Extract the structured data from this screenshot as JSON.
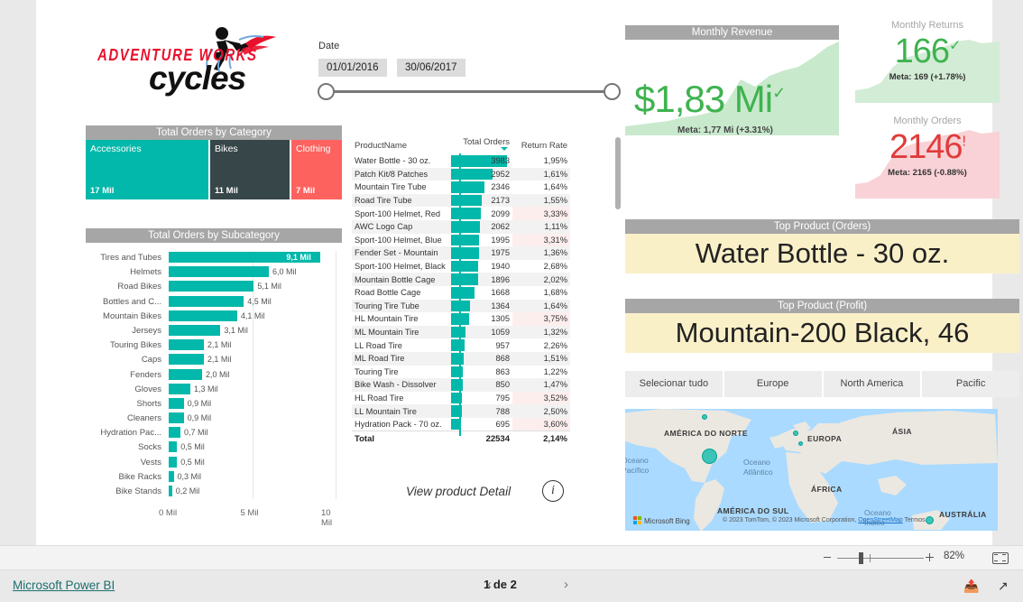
{
  "brand": {
    "top_text": "ADVENTURE WORKS",
    "bottom_text": "cycles",
    "logo_icon": "cyclist-logo-icon"
  },
  "slicer": {
    "label": "Date",
    "start": "01/01/2016",
    "end": "30/06/2017"
  },
  "treemap": {
    "title": "Total Orders by Category",
    "cells": [
      {
        "name": "Accessories",
        "value": "17 Mil",
        "color": "#01b8aa",
        "weight": 17
      },
      {
        "name": "Bikes",
        "value": "11 Mil",
        "color": "#374649",
        "weight": 11
      },
      {
        "name": "Clothing",
        "value": "7 Mil",
        "color": "#fd625e",
        "weight": 7
      }
    ]
  },
  "chart_data": {
    "type": "bar",
    "title": "Total Orders by Subcategory",
    "xlabel": "",
    "ylabel": "",
    "orientation": "horizontal",
    "xlim": [
      0,
      10
    ],
    "xticks": [
      "0 Mil",
      "5 Mil",
      "10 Mil"
    ],
    "bar_color": "#01b8aa",
    "categories": [
      "Tires and Tubes",
      "Helmets",
      "Road Bikes",
      "Bottles and C...",
      "Mountain Bikes",
      "Jerseys",
      "Touring Bikes",
      "Caps",
      "Fenders",
      "Gloves",
      "Shorts",
      "Cleaners",
      "Hydration Pac...",
      "Socks",
      "Vests",
      "Bike Racks",
      "Bike Stands"
    ],
    "values": [
      9.1,
      6.0,
      5.1,
      4.5,
      4.1,
      3.1,
      2.1,
      2.1,
      2.0,
      1.3,
      0.9,
      0.9,
      0.7,
      0.5,
      0.5,
      0.3,
      0.2
    ],
    "labels": [
      "9,1 Mil",
      "6,0 Mil",
      "5,1 Mil",
      "4,5 Mil",
      "4,1 Mil",
      "3,1 Mil",
      "2,1 Mil",
      "2,1 Mil",
      "2,0 Mil",
      "1,3 Mil",
      "0,9 Mil",
      "0,9 Mil",
      "0,7 Mil",
      "0,5 Mil",
      "0,5 Mil",
      "0,3 Mil",
      "0,2 Mil"
    ]
  },
  "table": {
    "columns": [
      "ProductName",
      "Total Orders",
      "Return Rate"
    ],
    "sorted_column": "Total Orders",
    "max_orders": 3983,
    "rows": [
      {
        "name": "Water Bottle - 30 oz.",
        "orders": "3983",
        "orders_num": 3983,
        "rate": "1,95%",
        "highlight": false
      },
      {
        "name": "Patch Kit/8 Patches",
        "orders": "2952",
        "orders_num": 2952,
        "rate": "1,61%",
        "highlight": false
      },
      {
        "name": "Mountain Tire Tube",
        "orders": "2346",
        "orders_num": 2346,
        "rate": "1,64%",
        "highlight": false
      },
      {
        "name": "Road Tire Tube",
        "orders": "2173",
        "orders_num": 2173,
        "rate": "1,55%",
        "highlight": false
      },
      {
        "name": "Sport-100 Helmet, Red",
        "orders": "2099",
        "orders_num": 2099,
        "rate": "3,33%",
        "highlight": true
      },
      {
        "name": "AWC Logo Cap",
        "orders": "2062",
        "orders_num": 2062,
        "rate": "1,11%",
        "highlight": false
      },
      {
        "name": "Sport-100 Helmet, Blue",
        "orders": "1995",
        "orders_num": 1995,
        "rate": "3,31%",
        "highlight": true
      },
      {
        "name": "Fender Set - Mountain",
        "orders": "1975",
        "orders_num": 1975,
        "rate": "1,36%",
        "highlight": false
      },
      {
        "name": "Sport-100 Helmet, Black",
        "orders": "1940",
        "orders_num": 1940,
        "rate": "2,68%",
        "highlight": false
      },
      {
        "name": "Mountain Bottle Cage",
        "orders": "1896",
        "orders_num": 1896,
        "rate": "2,02%",
        "highlight": false
      },
      {
        "name": "Road Bottle Cage",
        "orders": "1668",
        "orders_num": 1668,
        "rate": "1,68%",
        "highlight": false
      },
      {
        "name": "Touring Tire Tube",
        "orders": "1364",
        "orders_num": 1364,
        "rate": "1,64%",
        "highlight": false
      },
      {
        "name": "HL Mountain Tire",
        "orders": "1305",
        "orders_num": 1305,
        "rate": "3,75%",
        "highlight": true
      },
      {
        "name": "ML Mountain Tire",
        "orders": "1059",
        "orders_num": 1059,
        "rate": "1,32%",
        "highlight": false
      },
      {
        "name": "LL Road Tire",
        "orders": "957",
        "orders_num": 957,
        "rate": "2,26%",
        "highlight": false
      },
      {
        "name": "ML Road Tire",
        "orders": "868",
        "orders_num": 868,
        "rate": "1,51%",
        "highlight": false
      },
      {
        "name": "Touring Tire",
        "orders": "863",
        "orders_num": 863,
        "rate": "1,22%",
        "highlight": false
      },
      {
        "name": "Bike Wash - Dissolver",
        "orders": "850",
        "orders_num": 850,
        "rate": "1,47%",
        "highlight": false
      },
      {
        "name": "HL Road Tire",
        "orders": "795",
        "orders_num": 795,
        "rate": "3,52%",
        "highlight": true
      },
      {
        "name": "LL Mountain Tire",
        "orders": "788",
        "orders_num": 788,
        "rate": "2,50%",
        "highlight": false
      },
      {
        "name": "Hydration Pack - 70 oz.",
        "orders": "695",
        "orders_num": 695,
        "rate": "3,60%",
        "highlight": true
      }
    ],
    "total": {
      "label": "Total",
      "orders": "22534",
      "rate": "2,14%"
    }
  },
  "view_detail": {
    "label": "View product Detail",
    "icon": "info-icon"
  },
  "kpis": {
    "revenue": {
      "title": "Monthly Revenue",
      "value": "$1,83 Mi",
      "status_icon": "check-mark",
      "goal": "Meta: 1,77 Mi (+3.31%)",
      "color": "#3eb34f"
    },
    "returns": {
      "title": "Monthly Returns",
      "value": "166",
      "status_icon": "check-mark",
      "goal": "Meta: 169 (+1.78%)",
      "color": "#3eb34f"
    },
    "orders": {
      "title": "Monthly Orders",
      "value": "2146",
      "status_icon": "exclamation-mark",
      "goal": "Meta: 2165 (-0.88%)",
      "color": "#e03b3b"
    }
  },
  "top_products": [
    {
      "title": "Top Product (Orders)",
      "value": "Water Bottle - 30 oz."
    },
    {
      "title": "Top Product (Profit)",
      "value": "Mountain-200 Black, 46"
    }
  ],
  "regions": [
    "Selecionar tudo",
    "Europe",
    "North America",
    "Pacific"
  ],
  "map": {
    "labels": [
      "AMÉRICA DO NORTE",
      "EUROPA",
      "ÁSIA",
      "ÁFRICA",
      "AMÉRICA DO SUL",
      "AUSTRÁLIA"
    ],
    "oceans": [
      "Oceano Pacífico",
      "Oceano Atlântico",
      "Oceano Índico"
    ],
    "provider": "Microsoft Bing",
    "attribution": "© 2023 TomTom, © 2023 Microsoft Corporation,",
    "attribution_link": "OpenStreetMap",
    "attribution_tail": "Termos"
  },
  "zoombar": {
    "minus_icon": "zoom-out-icon",
    "plus_icon": "zoom-in-icon",
    "percent": "82%",
    "fit_icon": "fit-to-page-icon"
  },
  "footer": {
    "brand": "Microsoft Power BI",
    "prev_icon": "chevron-left-icon",
    "page_label": "1 de 2",
    "next_icon": "chevron-right-icon",
    "share_icon": "share-icon",
    "fullscreen_icon": "fullscreen-icon"
  }
}
